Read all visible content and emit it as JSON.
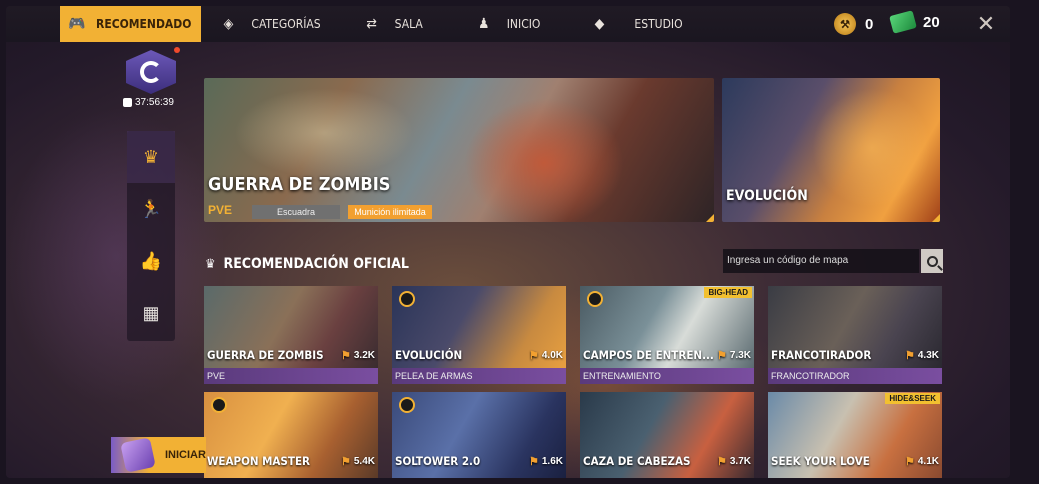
{
  "topbar": {
    "tabs": [
      {
        "label": "RECOMENDADO",
        "icon": "gamepad-icon",
        "active": true
      },
      {
        "label": "CATEGORÍAS",
        "icon": "layers-icon",
        "active": false
      },
      {
        "label": "SALA",
        "icon": "room-icon",
        "active": false
      },
      {
        "label": "INICIO",
        "icon": "person-icon",
        "active": false
      },
      {
        "label": "ESTUDIO",
        "icon": "studio-icon",
        "active": false
      }
    ],
    "currency_a": "0",
    "currency_b": "20"
  },
  "event": {
    "timer": "37:56:39"
  },
  "sidebar": {
    "items": [
      "crown-icon",
      "runner-icon",
      "thumbs-up-icon",
      "apps-icon"
    ]
  },
  "banners": {
    "main": {
      "title": "GUERRA DE ZOMBIS",
      "mode": "PVE",
      "chip1": "Escuadra",
      "chip2": "Munición ilimitada"
    },
    "side": {
      "title": "EVOLUCIÓN"
    }
  },
  "section": {
    "title": "RECOMENDACIÓN OFICIAL",
    "search_placeholder": "Ingresa un código de mapa"
  },
  "cards": [
    {
      "name": "GUERRA DE ZOMBIS",
      "count": "3.2K",
      "sub": "PVE"
    },
    {
      "name": "EVOLUCIÓN",
      "count": "4.0K",
      "sub": "PELEA DE ARMAS"
    },
    {
      "name": "CAMPOS DE ENTREN...",
      "count": "7.3K",
      "sub": "ENTRENAMIENTO",
      "tag": "BIG-HEAD"
    },
    {
      "name": "FRANCOTIRADOR",
      "count": "4.3K",
      "sub": "FRANCOTIRADOR"
    },
    {
      "name": "WEAPON MASTER",
      "count": "5.4K"
    },
    {
      "name": "SOLTOWER 2.0",
      "count": "1.6K"
    },
    {
      "name": "CAZA DE CABEZAS",
      "count": "3.7K"
    },
    {
      "name": "SEEK YOUR LOVE",
      "count": "4.1K",
      "tag": "HIDE&SEEK"
    }
  ],
  "start_button": "INICIAR"
}
